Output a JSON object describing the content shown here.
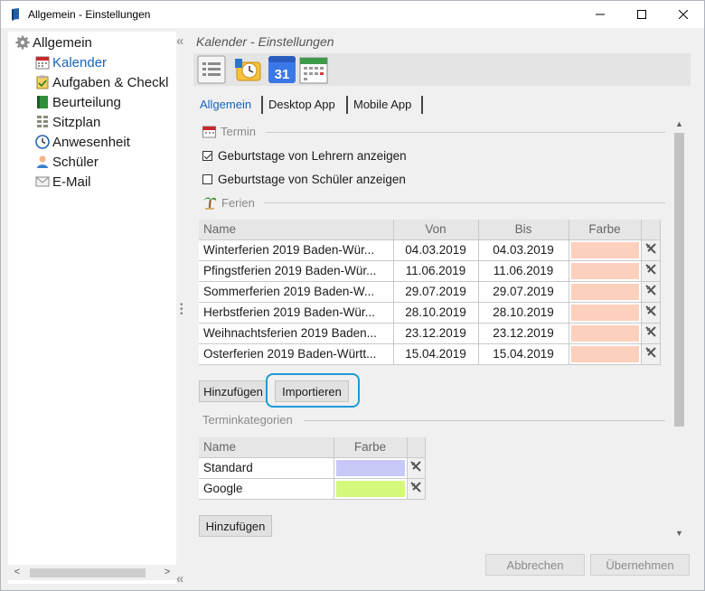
{
  "window": {
    "title": "Allgemein - Einstellungen",
    "controls": {
      "minimize": "—",
      "maximize": "☐",
      "close": "✕"
    }
  },
  "sidebar": {
    "items": [
      {
        "label": "Allgemein",
        "icon": "gear-icon"
      },
      {
        "label": "Kalender",
        "icon": "calendar-icon",
        "selected": true
      },
      {
        "label": "Aufgaben & Checkl",
        "icon": "clipboard-icon"
      },
      {
        "label": "Beurteilung",
        "icon": "book-icon"
      },
      {
        "label": "Sitzplan",
        "icon": "seating-icon"
      },
      {
        "label": "Anwesenheit",
        "icon": "clock-icon"
      },
      {
        "label": "Schüler",
        "icon": "student-icon"
      },
      {
        "label": "E-Mail",
        "icon": "mail-icon"
      }
    ]
  },
  "header": {
    "title": "Kalender - Einstellungen"
  },
  "toolbar": {
    "icons": [
      "list-icon",
      "outlook-icon",
      "google-calendar-icon",
      "calendar-app-icon"
    ],
    "google_day": "31"
  },
  "tabs": [
    {
      "label": "Allgemein",
      "active": true
    },
    {
      "label": "Desktop App"
    },
    {
      "label": "Mobile App"
    }
  ],
  "termin": {
    "section_label": "Termin",
    "checkboxes": [
      {
        "label": "Geburtstage von Lehrern anzeigen",
        "checked": true
      },
      {
        "label": "Geburtstage von Schüler anzeigen",
        "checked": false
      }
    ]
  },
  "ferien": {
    "section_label": "Ferien",
    "columns": [
      "Name",
      "Von",
      "Bis",
      "Farbe"
    ],
    "color": "#fdd0bd",
    "rows": [
      {
        "name": "Winterferien 2019 Baden-Wür...",
        "von": "04.03.2019",
        "bis": "04.03.2019"
      },
      {
        "name": "Pfingstferien 2019 Baden-Wür...",
        "von": "11.06.2019",
        "bis": "11.06.2019"
      },
      {
        "name": "Sommerferien 2019 Baden-W...",
        "von": "29.07.2019",
        "bis": "29.07.2019"
      },
      {
        "name": "Herbstferien 2019 Baden-Wür...",
        "von": "28.10.2019",
        "bis": "28.10.2019"
      },
      {
        "name": "Weihnachtsferien 2019 Baden...",
        "von": "23.12.2019",
        "bis": "23.12.2019"
      },
      {
        "name": "Osterferien 2019 Baden-Württ...",
        "von": "15.04.2019",
        "bis": "15.04.2019"
      }
    ],
    "add_button": "Hinzufügen",
    "import_button": "Importieren"
  },
  "kategorien": {
    "section_label": "Terminkategorien",
    "columns": [
      "Name",
      "Farbe"
    ],
    "rows": [
      {
        "name": "Standard",
        "color": "#c8c8f8"
      },
      {
        "name": "Google",
        "color": "#d4f87c"
      }
    ],
    "add_button": "Hinzufügen"
  },
  "footer": {
    "cancel": "Abbrechen",
    "apply": "Übernehmen"
  },
  "colors": {
    "accent": "#1a63b8",
    "highlight": "#1e9ad6"
  }
}
